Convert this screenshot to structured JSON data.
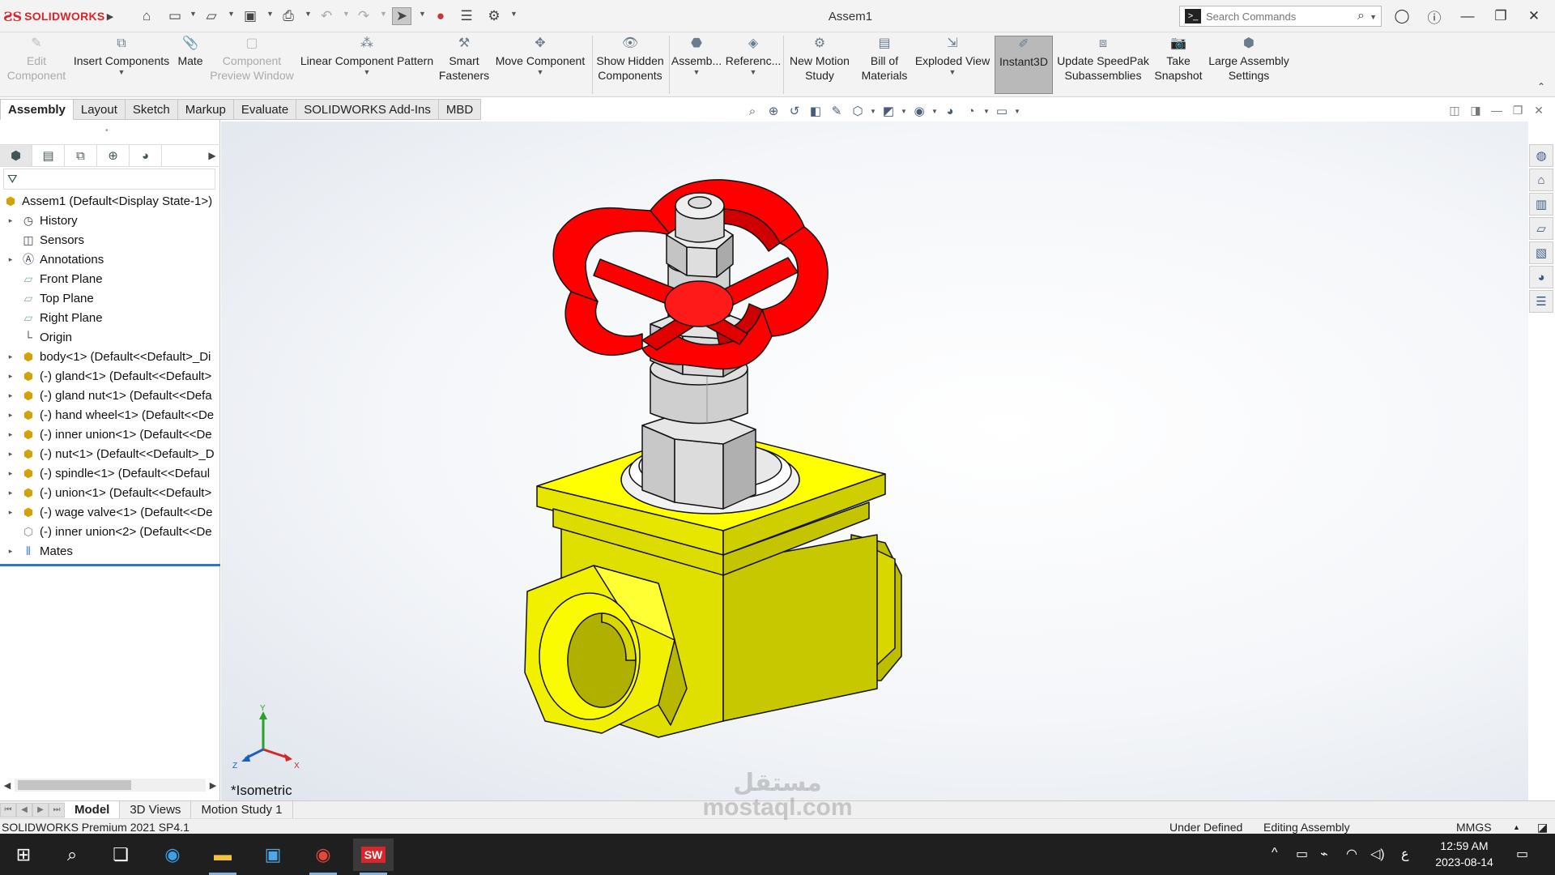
{
  "titlebar": {
    "brand": "SOLIDWORKS",
    "document_title": "Assem1",
    "search_placeholder": "Search Commands"
  },
  "command_manager": [
    {
      "label_1": "Edit",
      "label_2": "Component",
      "icon": "edit-component-icon",
      "enabled": false
    },
    {
      "label_1": "Insert Components",
      "label_2": "",
      "icon": "insert-components-icon",
      "enabled": true
    },
    {
      "label_1": "Mate",
      "label_2": "",
      "icon": "mate-icon",
      "enabled": true
    },
    {
      "label_1": "Component",
      "label_2": "Preview Window",
      "icon": "preview-window-icon",
      "enabled": false
    },
    {
      "label_1": "Linear Component Pattern",
      "label_2": "",
      "icon": "linear-pattern-icon",
      "enabled": true
    },
    {
      "label_1": "Smart",
      "label_2": "Fasteners",
      "icon": "smart-fasteners-icon",
      "enabled": true
    },
    {
      "label_1": "Move Component",
      "label_2": "",
      "icon": "move-component-icon",
      "enabled": true
    },
    {
      "label_1": "Show Hidden",
      "label_2": "Components",
      "icon": "show-hidden-icon",
      "enabled": true
    },
    {
      "label_1": "Assemb...",
      "label_2": "",
      "icon": "assembly-features-icon",
      "enabled": true
    },
    {
      "label_1": "Referenc...",
      "label_2": "",
      "icon": "reference-geometry-icon",
      "enabled": true
    },
    {
      "label_1": "New Motion",
      "label_2": "Study",
      "icon": "motion-study-icon",
      "enabled": true
    },
    {
      "label_1": "Bill of",
      "label_2": "Materials",
      "icon": "bill-of-materials-icon",
      "enabled": true
    },
    {
      "label_1": "Exploded View",
      "label_2": "",
      "icon": "exploded-view-icon",
      "enabled": true
    },
    {
      "label_1": "Instant3D",
      "label_2": "",
      "icon": "instant3d-icon",
      "enabled": true
    },
    {
      "label_1": "Update SpeedPak",
      "label_2": "Subassemblies",
      "icon": "speedpak-icon",
      "enabled": true
    },
    {
      "label_1": "Take",
      "label_2": "Snapshot",
      "icon": "camera-icon",
      "enabled": true
    },
    {
      "label_1": "Large Assembly",
      "label_2": "Settings",
      "icon": "large-assembly-icon",
      "enabled": true
    }
  ],
  "tabs": [
    "Assembly",
    "Layout",
    "Sketch",
    "Markup",
    "Evaluate",
    "SOLIDWORKS Add-Ins",
    "MBD"
  ],
  "tree": [
    {
      "label": "Assem1  (Default<Display State-1>)",
      "icon": "assembly-icon",
      "expandable": false
    },
    {
      "label": "History",
      "icon": "history-icon",
      "expandable": true
    },
    {
      "label": "Sensors",
      "icon": "sensors-icon",
      "expandable": false
    },
    {
      "label": "Annotations",
      "icon": "annotations-icon",
      "expandable": true
    },
    {
      "label": "Front Plane",
      "icon": "plane-icon",
      "expandable": false
    },
    {
      "label": "Top Plane",
      "icon": "plane-icon",
      "expandable": false
    },
    {
      "label": "Right Plane",
      "icon": "plane-icon",
      "expandable": false
    },
    {
      "label": "Origin",
      "icon": "origin-icon",
      "expandable": false
    },
    {
      "label": "body<1> (Default<<Default>_Di",
      "icon": "part-icon",
      "expandable": true
    },
    {
      "label": "(-) gland<1> (Default<<Default>",
      "icon": "part-icon",
      "expandable": true
    },
    {
      "label": "(-) gland nut<1> (Default<<Defa",
      "icon": "part-icon",
      "expandable": true
    },
    {
      "label": "(-) hand wheel<1> (Default<<De",
      "icon": "part-icon",
      "expandable": true
    },
    {
      "label": "(-) inner union<1> (Default<<De",
      "icon": "part-icon",
      "expandable": true
    },
    {
      "label": "(-) nut<1> (Default<<Default>_D",
      "icon": "part-icon",
      "expandable": true
    },
    {
      "label": "(-) spindle<1> (Default<<Defaul",
      "icon": "part-icon",
      "expandable": true
    },
    {
      "label": "(-) union<1> (Default<<Default>",
      "icon": "part-icon",
      "expandable": true
    },
    {
      "label": "(-) wage valve<1> (Default<<De",
      "icon": "part-icon",
      "expandable": true
    },
    {
      "label": "(-) inner union<2> (Default<<De",
      "icon": "part-outline-icon",
      "expandable": false
    },
    {
      "label": "Mates",
      "icon": "mates-icon",
      "expandable": true
    }
  ],
  "viewport": {
    "view_name": "*Isometric",
    "triad": {
      "x": "X",
      "y": "Y",
      "z": "Z"
    },
    "colors": {
      "hand_wheel": "#ff0000",
      "body": "#ffff00",
      "metal": "#d0d0d0"
    }
  },
  "bottom_tabs": [
    "Model",
    "3D Views",
    "Motion Study 1"
  ],
  "status": {
    "product": "SOLIDWORKS Premium 2021 SP4.1",
    "state": "Under Defined",
    "mode": "Editing Assembly",
    "units": "MMGS"
  },
  "taskbar": {
    "time": "12:59 AM",
    "date": "2023-08-14",
    "lang": "ع"
  },
  "watermark": {
    "line1": "مستقل",
    "line2": "mostaql.com"
  }
}
